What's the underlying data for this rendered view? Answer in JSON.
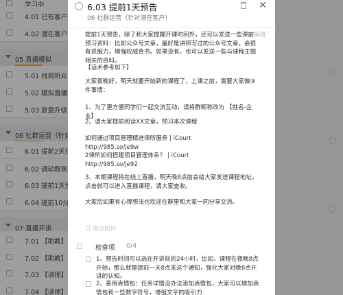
{
  "background": {
    "rows": [
      {
        "kind": "item",
        "label": "学习中"
      },
      {
        "kind": "item",
        "label": "4.01 已有客户"
      },
      {
        "kind": "item",
        "label": "4.02 潜在客户"
      },
      {
        "kind": "group",
        "label": "05 直播模拟"
      },
      {
        "kind": "item",
        "label": "5.01 找到听众"
      },
      {
        "kind": "item",
        "label": "5.02 模拟直播环节"
      },
      {
        "kind": "item",
        "label": "5.03 复盘升级流程"
      },
      {
        "kind": "group",
        "label": "06 社群运营（针对"
      },
      {
        "kind": "item",
        "label": "6.01 提前2天拉群"
      },
      {
        "kind": "item",
        "label": "6.02 调动群氛围"
      },
      {
        "kind": "item",
        "label": "6.03 提前1天预告"
      },
      {
        "kind": "item",
        "label": "6.04 提前10分钟"
      },
      {
        "kind": "group",
        "label": "07 直播开讲"
      },
      {
        "kind": "item",
        "label": "7.01 【助教】群通"
      },
      {
        "kind": "item",
        "label": "7.02 【助教】开场"
      },
      {
        "kind": "item",
        "label": "7.03 【讲师】讲课"
      },
      {
        "kind": "item",
        "label": "7.04 【讲师】正式"
      }
    ]
  },
  "modal": {
    "title": "6.03 提前1天预告",
    "subtitle": "06 社群运营（针对潜在客户）",
    "close_glyph": "✕",
    "edit_label": "编辑",
    "body": [
      "提前1天预告，除了和大家提醒开课时间外，还可以发送一些课前预习资料：比如公众号文章，最好是讲师写过的公众号文章，会很有说服力，增强权威背书。如果没有，也可以发送一些与课程主题相关的资料。",
      "【话术参考如下】",
      "大家夜晚好，明天就要开始新的课程了，上课之前，需要大家做③件事情：",
      "1、为了更方便同学们一起交流互动，请将群昵称改为 【姓名-企业】",
      "2、请大家提前阅读XX文章，预习本次课程",
      "如何通过项目管理精进律所服务 | iCourt\nhttp://985.so/je9w\n2律所如何搭建项目管理体系？ | iCourt\nhttp://985.so/je92",
      "3、本期课程将在线上直播，明天晚8点前会给大家发送课程地址，点击就可以进入直播课程，请大家查收。",
      "大家后如果有心得想法也欢迎在群里和大家一同分享交流。"
    ],
    "attach_label": "添加附件",
    "checklist": {
      "label": "检查项",
      "count": "0/4",
      "items": [
        "1、预告时间可以选在开讲前的24小时，比如，课程在夜晚8点开始，那么就是提前一天8点发这个通知，强化大家对晚8点开讲的认知。",
        "2、善用表情包：任务详情没办法添加表情包，大家可以增加表情包和一些数字符号，增强文字的吸引力"
      ]
    }
  },
  "colors": {
    "accent_orange": "#f2a94b",
    "overlay": "rgba(0,0,0,0.38)"
  }
}
